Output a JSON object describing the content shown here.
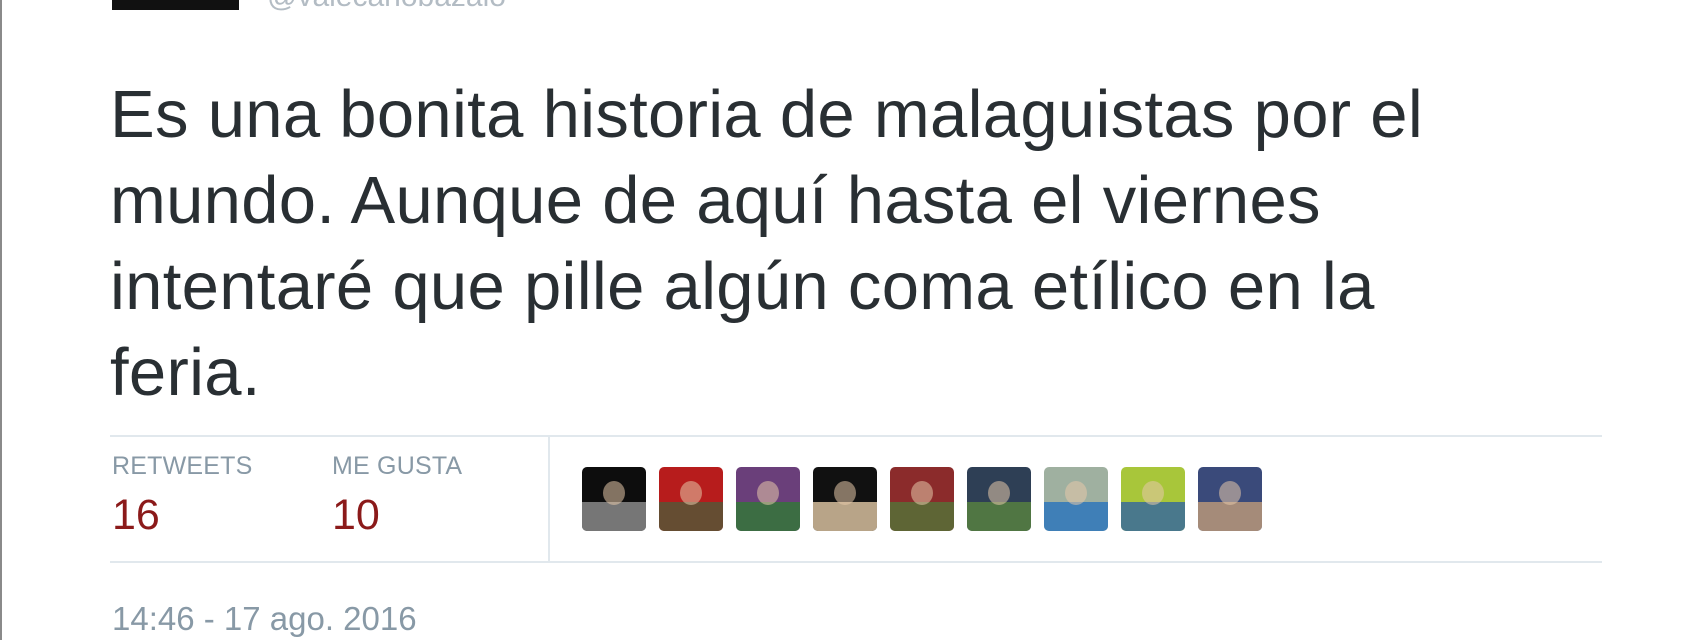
{
  "header": {
    "handle": "@valecanobazalo"
  },
  "tweet": {
    "lines": [
      "Es una bonita historia de malaguistas por el",
      "mundo. Aunque de aquí hasta el viernes",
      "intentaré que pille algún coma etílico en la",
      "feria."
    ]
  },
  "stats": {
    "retweets_label": "RETWEETS",
    "retweets_value": "16",
    "likes_label": "ME GUSTA",
    "likes_value": "10"
  },
  "likers": [
    {
      "name": "liker-1-avatar",
      "bg": "#0d0d0d",
      "accent": "#9a9a9a"
    },
    {
      "name": "liker-2-avatar",
      "bg": "#b71c1c",
      "accent": "#4a5d3a"
    },
    {
      "name": "liker-3-avatar",
      "bg": "#6a3f7a",
      "accent": "#2e7d32"
    },
    {
      "name": "liker-4-avatar",
      "bg": "#111111",
      "accent": "#f0d6b0"
    },
    {
      "name": "liker-5-avatar",
      "bg": "#8b2b2b",
      "accent": "#4f7a3a"
    },
    {
      "name": "liker-6-avatar",
      "bg": "#2e3f55",
      "accent": "#5c8a3e"
    },
    {
      "name": "liker-7-avatar",
      "bg": "#9fb0a0",
      "accent": "#1f6fbf"
    },
    {
      "name": "liker-8-avatar",
      "bg": "#a8c63a",
      "accent": "#2a5ea8"
    },
    {
      "name": "liker-9-avatar",
      "bg": "#3a4a7a",
      "accent": "#c9a27a"
    }
  ],
  "footer": {
    "timestamp": "14:46 - 17 ago. 2016"
  }
}
